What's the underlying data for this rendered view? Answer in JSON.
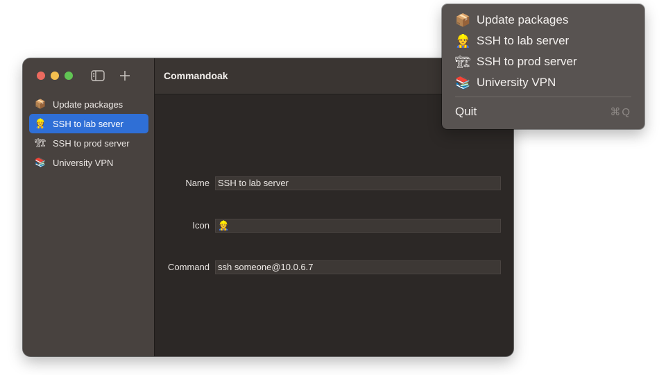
{
  "window": {
    "title": "Commandoak"
  },
  "sidebar": {
    "items": [
      {
        "icon": "📦",
        "icon_name": "package-icon",
        "label": "Update packages",
        "selected": false
      },
      {
        "icon": "👷",
        "icon_name": "worker-icon",
        "label": "SSH to lab server",
        "selected": true
      },
      {
        "icon": "🏗",
        "icon_name": "crane-icon",
        "label": "SSH to prod server",
        "selected": false
      },
      {
        "icon": "📚",
        "icon_name": "books-icon",
        "label": "University VPN",
        "selected": false
      }
    ]
  },
  "form": {
    "name_label": "Name",
    "name_value": "SSH to lab server",
    "icon_label": "Icon",
    "icon_value": "👷",
    "command_label": "Command",
    "command_value": "ssh someone@10.0.6.7"
  },
  "menu": {
    "items": [
      {
        "icon": "📦",
        "label": "Update packages"
      },
      {
        "icon": "👷",
        "label": "SSH to lab server"
      },
      {
        "icon": "🏗",
        "label": "SSH to prod server"
      },
      {
        "icon": "📚",
        "label": "University VPN"
      }
    ],
    "quit_label": "Quit",
    "quit_shortcut": "⌘Q"
  },
  "colors": {
    "accent": "#2f6fd6",
    "close": "#ec6a5f",
    "minimize": "#f4bf4f",
    "zoom": "#61c554"
  }
}
